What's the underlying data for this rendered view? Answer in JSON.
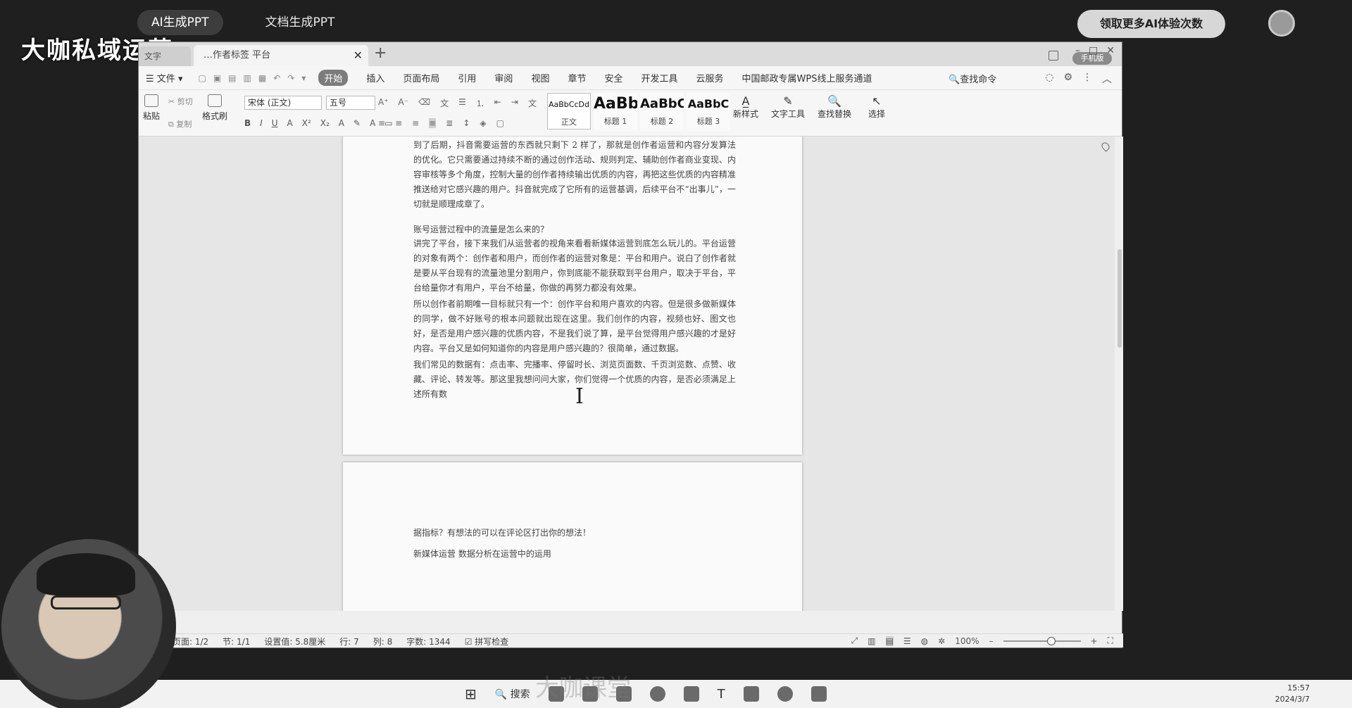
{
  "outer": {
    "tabs": [
      "AI生成PPT",
      "文档生成PPT"
    ],
    "promo": "领取更多AI体验次数",
    "brand": "大咖私域运营"
  },
  "window": {
    "left_tab": "文字",
    "doc_tab": "…作者标签 平台",
    "mode_btn": "手机版"
  },
  "menu": {
    "file": "文件",
    "items": [
      "开始",
      "插入",
      "页面布局",
      "引用",
      "审阅",
      "视图",
      "章节",
      "安全",
      "开发工具",
      "云服务",
      "中国邮政专属WPS线上服务通道"
    ],
    "find": "查找命令"
  },
  "ribbon": {
    "paste": "粘贴",
    "cut": "剪切",
    "copy": "复制",
    "format_painter": "格式刷",
    "font": "宋体 (正文)",
    "size": "五号",
    "styles": [
      {
        "sample": "AaBbCcDd",
        "name": "正文"
      },
      {
        "sample": "AaBb",
        "name": "标题 1"
      },
      {
        "sample": "AaBbC",
        "name": "标题 2"
      },
      {
        "sample": "AaBbC",
        "name": "标题 3"
      }
    ],
    "new_style": "新样式",
    "text_tools": "文字工具",
    "find_replace": "查找替换",
    "select": "选择"
  },
  "document": {
    "paragraphs": [
      "到了后期，抖音需要运营的东西就只剩下 2 样了，那就是创作者运营和内容分发算法的优化。它只需要通过持续不断的通过创作活动、规则判定、辅助创作者商业变现、内容审核等多个角度，控制大量的创作者持续输出优质的内容，再把这些优质的内容精准推送给对它感兴趣的用户。抖音就完成了它所有的运营基调，后续平台不“出事儿”，一切就是顺理成章了。",
      "账号运营过程中的流量是怎么来的？",
      "讲完了平台，接下来我们从运营者的视角来看看新媒体运营到底怎么玩儿的。平台运营的对象有两个：创作者和用户，而创作者的运营对象是：平台和用户。说白了创作者就是要从平台现有的流量池里分割用户，你到底能不能获取到平台用户，取决于平台，平台给量你才有用户，平台不给量，你做的再努力都没有效果。",
      "所以创作者前期唯一目标就只有一个：创作平台和用户喜欢的内容。但是很多做新媒体的同学，做不好账号的根本问题就出现在这里。我们创作的内容，视频也好、图文也好，是否是用户感兴趣的优质内容，不是我们说了算，是平台觉得用户感兴趣的才是好内容。平台又是如何知道你的内容是用户感兴趣的？很简单，通过数据。",
      "我们常见的数据有：点击率、完播率、停留时长、浏览页面数、千页浏览数、点赞、收藏、评论、转发等。那这里我想问问大家，你们觉得一个优质的内容，是否必须满足上述所有数"
    ],
    "page2_paragraphs": [
      "据指标？有想法的可以在评论区打出你的想法！",
      "新媒体运营 数据分析在运营中的运用"
    ]
  },
  "status": {
    "page": "页面: 1/2",
    "section": "节: 1/1",
    "setting": "设置值: 5.8厘米",
    "row": "行: 7",
    "col": "列: 8",
    "words": "字数: 1344",
    "spell": "拼写检查",
    "zoom": "100%"
  },
  "taskbar": {
    "search": "搜索",
    "time": "15:57",
    "date": "2024/3/7"
  },
  "watermark": "大咖课堂"
}
